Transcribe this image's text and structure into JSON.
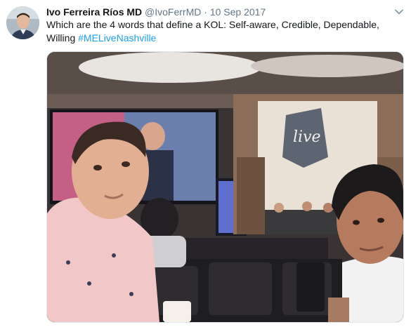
{
  "tweet": {
    "author_name": "Ivo Ferreira Ríos MD",
    "handle": "@IvoFerrMD",
    "separator": "·",
    "date": "10 Sep 2017",
    "text": "Which are the 4 words that define a KOL: Self-aware, Credible, Dependable, Willing",
    "hashtag": "#MELiveNashville"
  },
  "icons": {
    "more": "chevron-down-icon"
  },
  "colors": {
    "link": "#1da1f2",
    "secondary_text": "#657786",
    "primary_text": "#14171a"
  }
}
